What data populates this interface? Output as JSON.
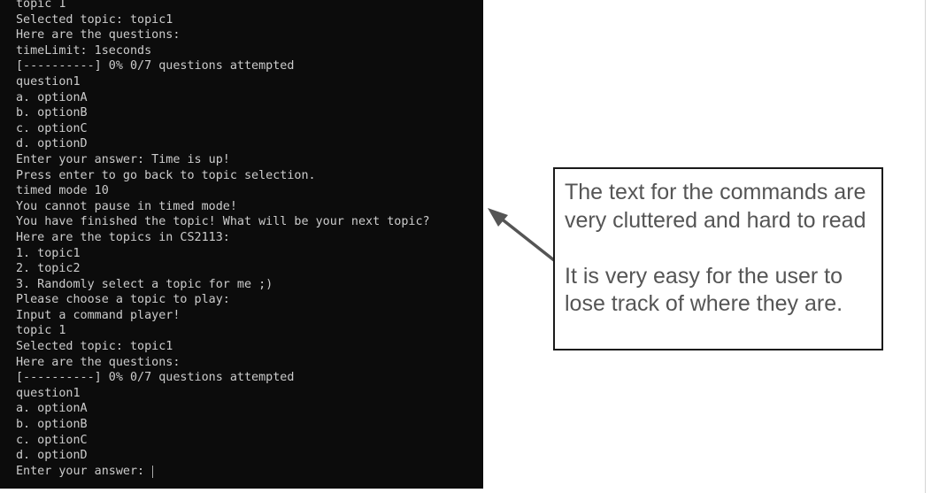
{
  "terminal": {
    "lines": [
      "topic 1",
      "Selected topic: topic1",
      "Here are the questions:",
      "timeLimit: 1seconds",
      "[----------] 0% 0/7 questions attempted",
      "question1",
      "a. optionA",
      "b. optionB",
      "c. optionC",
      "d. optionD",
      "Enter your answer: Time is up!",
      "Press enter to go back to topic selection.",
      "timed mode 10",
      "You cannot pause in timed mode!",
      "You have finished the topic! What will be your next topic?",
      "Here are the topics in CS2113:",
      "1. topic1",
      "2. topic2",
      "3. Randomly select a topic for me ;)",
      "Please choose a topic to play:",
      "Input a command player!",
      "topic 1",
      "Selected topic: topic1",
      "Here are the questions:",
      "[----------] 0% 0/7 questions attempted",
      "question1",
      "a. optionA",
      "b. optionB",
      "c. optionC",
      "d. optionD"
    ],
    "prompt": "Enter your answer:"
  },
  "callout": {
    "paragraph1": "The text for the commands are very cluttered and hard to read",
    "paragraph2": "It is very easy for the user to lose track of where they are."
  },
  "colors": {
    "terminal_bg": "#0c0c0c",
    "terminal_text": "#cccccc",
    "callout_text": "#555555",
    "arrow": "#555555"
  }
}
